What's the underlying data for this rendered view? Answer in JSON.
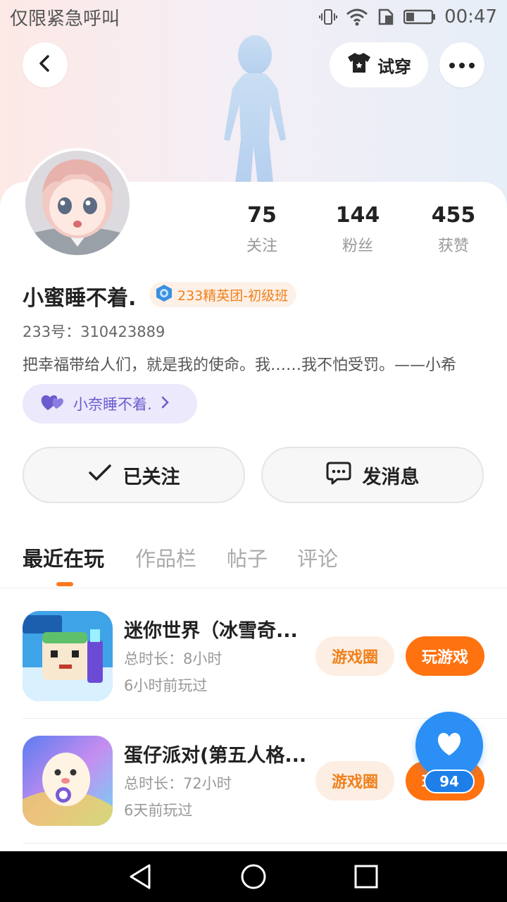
{
  "status_bar": {
    "left_text": "仅限紧急呼叫",
    "time": "00:47",
    "icons": [
      "vibrate-icon",
      "wifi-icon",
      "sim-icon",
      "battery-icon"
    ]
  },
  "header": {
    "try_on_label": "试穿",
    "icons": [
      "back-arrow-icon",
      "tshirt-icon",
      "more-icon"
    ]
  },
  "profile": {
    "stats": [
      {
        "value": "75",
        "label": "关注"
      },
      {
        "value": "144",
        "label": "粉丝"
      },
      {
        "value": "455",
        "label": "获赞"
      }
    ],
    "name": "小蜜睡不着.",
    "badge": "233精英团-初级班",
    "uid": "233号：310423889",
    "bio": "把幸福带给人们，就是我的使命。我……我不怕受罚。——小希",
    "cp_name": "小奈睡不着."
  },
  "actions": {
    "follow_label": "已关注",
    "message_label": "发消息"
  },
  "tabs": [
    {
      "label": "最近在玩",
      "active": true
    },
    {
      "label": "作品栏",
      "active": false
    },
    {
      "label": "帖子",
      "active": false
    },
    {
      "label": "评论",
      "active": false
    }
  ],
  "games": [
    {
      "title": "迷你世界（冰雪奇...",
      "duration": "总时长：8小时",
      "last_played": "6小时前玩过",
      "circle_label": "游戏圈",
      "play_label": "玩游戏",
      "icon": "mini-world-icon"
    },
    {
      "title": "蛋仔派对(第五人格...",
      "duration": "总时长：72小时",
      "last_played": "6天前玩过",
      "circle_label": "游戏圈",
      "play_label": "玩游戏",
      "icon": "eggy-party-icon"
    }
  ],
  "like_fab": {
    "count": "94"
  },
  "colors": {
    "accent": "#ff7210",
    "like_blue": "#2b8ff5",
    "cp_purple": "#6a5ccd"
  }
}
